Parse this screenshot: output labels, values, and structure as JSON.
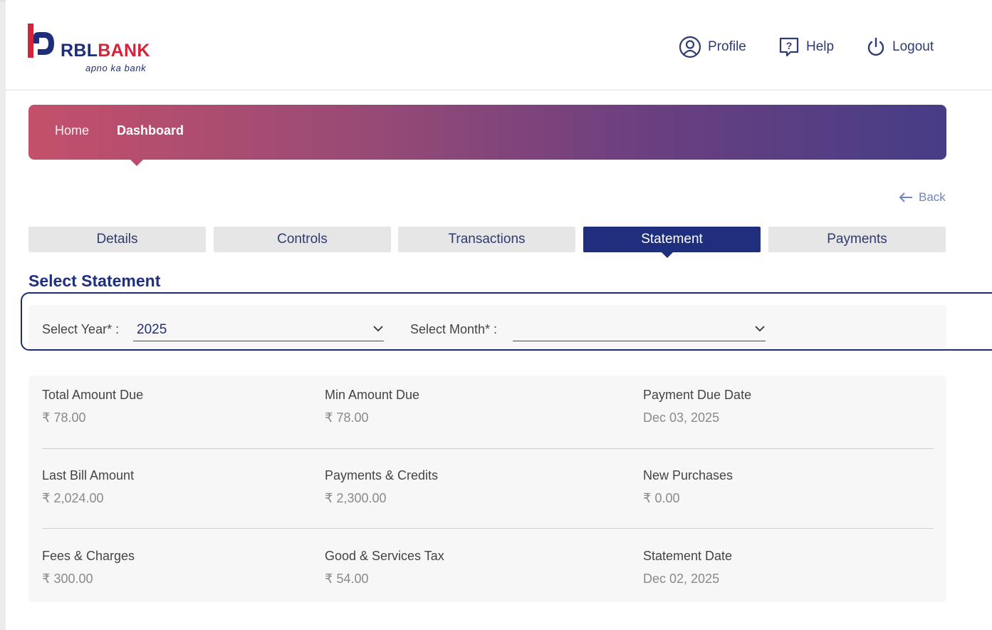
{
  "brand": {
    "name_part1": "RBL",
    "name_part2": "BANK",
    "tagline": "apno ka bank"
  },
  "header": {
    "profile_label": "Profile",
    "help_label": "Help",
    "logout_label": "Logout"
  },
  "breadcrumb": {
    "home": "Home",
    "current": "Dashboard"
  },
  "back_label": "Back",
  "tabs": [
    {
      "label": "Details",
      "active": false
    },
    {
      "label": "Controls",
      "active": false
    },
    {
      "label": "Transactions",
      "active": false
    },
    {
      "label": "Statement",
      "active": true
    },
    {
      "label": "Payments",
      "active": false
    }
  ],
  "section_title": "Select Statement",
  "selectors": {
    "year_label": "Select Year* :",
    "year_value": "2025",
    "month_label": "Select Month* :",
    "month_value": ""
  },
  "summary": [
    {
      "label": "Total Amount Due",
      "value": "₹ 78.00"
    },
    {
      "label": "Min Amount Due",
      "value": "₹ 78.00"
    },
    {
      "label": "Payment Due Date",
      "value": "Dec 03, 2025"
    },
    {
      "label": "Last Bill Amount",
      "value": "₹ 2,024.00"
    },
    {
      "label": "Payments & Credits",
      "value": "₹ 2,300.00"
    },
    {
      "label": "New Purchases",
      "value": "₹ 0.00"
    },
    {
      "label": "Fees & Charges",
      "value": "₹ 300.00"
    },
    {
      "label": "Good & Services Tax",
      "value": "₹ 54.00"
    },
    {
      "label": "Statement Date",
      "value": "Dec 02, 2025"
    }
  ],
  "colors": {
    "brand_blue": "#1f2f7d",
    "brand_red": "#d2243a",
    "banner_start": "#c4506a",
    "banner_end": "#463d86",
    "active_tab": "#1f2f7d"
  }
}
